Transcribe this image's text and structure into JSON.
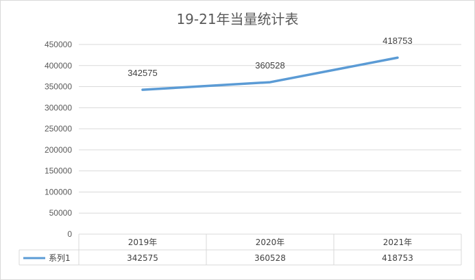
{
  "chart_data": {
    "type": "line",
    "title": "19-21年当量统计表",
    "categories": [
      "2019年",
      "2020年",
      "2021年"
    ],
    "series": [
      {
        "name": "系列1",
        "values": [
          342575,
          360528,
          418753
        ],
        "color": "#5b9bd5"
      }
    ],
    "ylim": [
      0,
      450000
    ],
    "yticks": [
      0,
      50000,
      100000,
      150000,
      200000,
      250000,
      300000,
      350000,
      400000,
      450000
    ],
    "yticks_labels": [
      "0",
      "50000",
      "100000",
      "150000",
      "200000",
      "250000",
      "300000",
      "350000",
      "400000",
      "450000"
    ],
    "grid": true,
    "data_table": true,
    "data_labels": [
      "342575",
      "360528",
      "418753"
    ],
    "gridline_color": "#d9d9d9"
  }
}
